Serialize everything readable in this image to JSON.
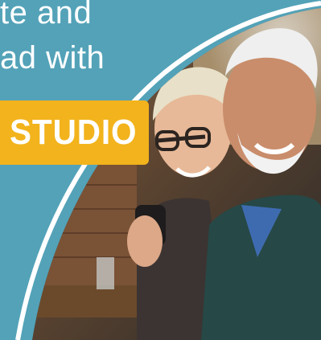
{
  "headline": {
    "line1": "te and",
    "line2": "ad with"
  },
  "banner": {
    "label": "STUDIO"
  },
  "colors": {
    "panel": "#53a2b8",
    "banner": "#f2b31c",
    "text": "#ffffff"
  }
}
